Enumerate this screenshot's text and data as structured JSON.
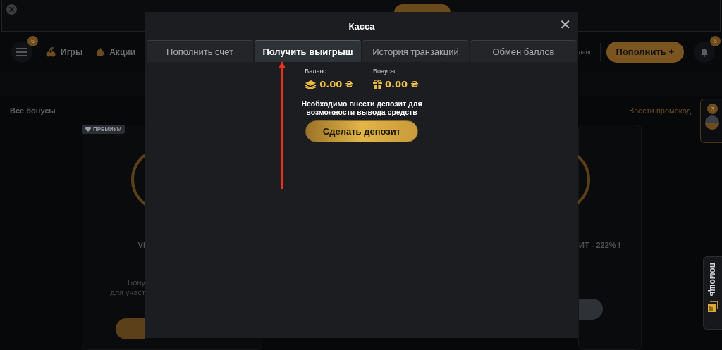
{
  "header": {
    "menu_badge": "6",
    "nav": [
      {
        "label": "Игры"
      },
      {
        "label": "Акции"
      }
    ],
    "balance_label": "ланс:",
    "deposit_button": "Пополнить +",
    "notifications_badge": "6"
  },
  "bonuses": {
    "title": "Все бонусы",
    "promo_link": "Ввести промокод",
    "cards": [
      {
        "badge": "ПРЕМИУМ",
        "title": "VI",
        "description": [
          "Бону",
          "для участ"
        ]
      },
      {
        "title": "ИТ - 222% !"
      }
    ]
  },
  "side_widget": {
    "badge": "3"
  },
  "help_tab": {
    "label": "помощь"
  },
  "modal": {
    "title": "Касса",
    "close": "✕",
    "tabs": [
      {
        "label": "Пополнить счет",
        "selected": false
      },
      {
        "label": "Получить выигрыш",
        "selected": true
      },
      {
        "label": "История транзакций",
        "selected": false
      },
      {
        "label": "Обмен баллов",
        "selected": false
      }
    ],
    "wallets": [
      {
        "label": "Баланс",
        "amount": "0.00 ₴"
      },
      {
        "label": "Бонусы",
        "amount": "0.00 ₴"
      }
    ],
    "message": "Необходимо внести депозит для возможности вывода средств",
    "button": "Сделать депозит"
  }
}
